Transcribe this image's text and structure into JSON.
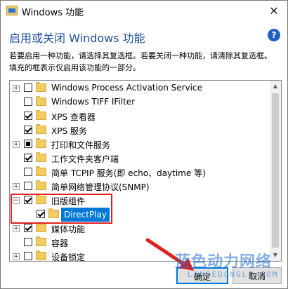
{
  "window": {
    "title": "Windows 功能",
    "close_symbol": "✕"
  },
  "header": {
    "heading": "启用或关闭 Windows 功能",
    "help_icon": "question-mark-icon",
    "help_symbol": "?",
    "description": "若要启用一种功能，请选择其复选框。若要关闭一种功能，请清除其复选框。填充的框表示仅启用该功能的一部分。"
  },
  "features": [
    {
      "label": "Windows Process Activation Service",
      "expander": "+",
      "state": "unchecked"
    },
    {
      "label": "Windows TIFF IFilter",
      "expander": "",
      "state": "unchecked"
    },
    {
      "label": "XPS 查看器",
      "expander": "",
      "state": "checked"
    },
    {
      "label": "XPS 服务",
      "expander": "",
      "state": "checked"
    },
    {
      "label": "打印和文件服务",
      "expander": "+",
      "state": "partial"
    },
    {
      "label": "工作文件夹客户端",
      "expander": "",
      "state": "checked"
    },
    {
      "label": "简单 TCPIP 服务(即 echo、daytime 等)",
      "expander": "",
      "state": "unchecked"
    },
    {
      "label": "简单网络管理协议(SNMP)",
      "expander": "+",
      "state": "unchecked"
    },
    {
      "label": "旧版组件",
      "expander": "−",
      "state": "checked"
    },
    {
      "label": "DirectPlay",
      "expander": "",
      "state": "checked",
      "child": true,
      "selected": true
    },
    {
      "label": "媒体功能",
      "expander": "+",
      "state": "checked"
    },
    {
      "label": "容器",
      "expander": "",
      "state": "unchecked"
    },
    {
      "label": "设备锁定",
      "expander": "+",
      "state": "unchecked"
    }
  ],
  "buttons": {
    "ok": "确定",
    "cancel": "取消"
  },
  "watermark": {
    "main": "蓝色动力网络",
    "sub": "LANSEDONGLI.COM"
  },
  "colors": {
    "heading": "#1e4e9c",
    "selection": "#0078d7",
    "highlight_box": "#e02020",
    "folder": "#f1cc61"
  }
}
